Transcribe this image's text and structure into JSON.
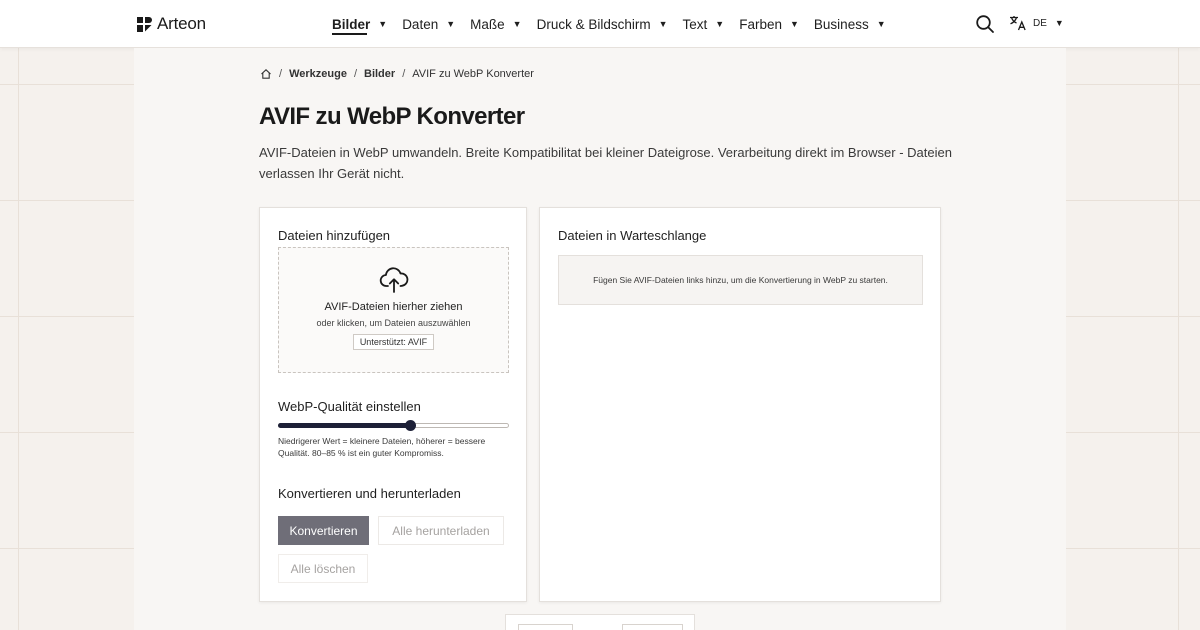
{
  "brand": {
    "name": "Arteon"
  },
  "nav": {
    "items": [
      {
        "label": "Bilder",
        "active": true
      },
      {
        "label": "Daten"
      },
      {
        "label": "Maße"
      },
      {
        "label": "Druck & Bildschirm"
      },
      {
        "label": "Text"
      },
      {
        "label": "Farben"
      },
      {
        "label": "Business"
      }
    ],
    "language": "DE"
  },
  "breadcrumb": {
    "items": [
      "Werkzeuge",
      "Bilder"
    ],
    "current": "AVIF zu WebP Konverter"
  },
  "page": {
    "title": "AVIF zu WebP Konverter",
    "description": "AVIF-Dateien in WebP umwandeln. Breite Kompatibilitat bei kleiner Dateigrose. Verarbeitung direkt im Browser - Dateien verlassen Ihr Gerät nicht."
  },
  "upload": {
    "heading": "Dateien hinzufügen",
    "drop_title": "AVIF-Dateien hierher ziehen",
    "drop_sub": "oder klicken, um Dateien auszuwählen",
    "supported": "Unterstützt: AVIF"
  },
  "quality": {
    "heading": "WebP-Qualität einstellen",
    "value_fraction": 0.57,
    "hint": "Niedrigerer Wert = kleinere Dateien, höherer = bessere Qualität. 80–85 % ist ein guter Kompromiss."
  },
  "actions": {
    "heading": "Konvertieren und herunterladen",
    "convert": "Konvertieren",
    "download_all": "Alle herunterladen",
    "delete_all": "Alle löschen"
  },
  "queue": {
    "heading": "Dateien in Warteschlange",
    "empty_message": "Fügen Sie AVIF-Dateien links hinzu, um die Konvertierung in WebP zu starten."
  },
  "colors": {
    "accent": "#1d2037",
    "button_primary": "#6f6e78"
  }
}
